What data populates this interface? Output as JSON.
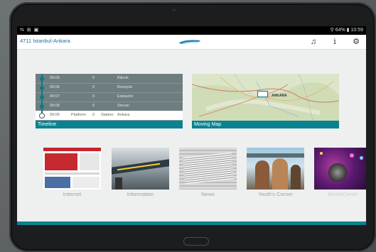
{
  "statusbar": {
    "left_icons": "⇆ ⊞ ▣",
    "right": "⚲ 64% ▮ 10:59"
  },
  "appbar": {
    "route_title": "4711 İstanbul-Ankara",
    "icons": [
      "music-icon",
      "info-icon",
      "settings-icon"
    ]
  },
  "timeline": {
    "caption": "Timeline",
    "rows": [
      {
        "time": "09:05",
        "platform": "0",
        "station": "Bilecik"
      },
      {
        "time": "09:06",
        "platform": "0",
        "station": "Bozüyük"
      },
      {
        "time": "09:07",
        "platform": "0",
        "station": "Eskişehir"
      },
      {
        "time": "09:08",
        "platform": "0",
        "station": "Sincan"
      },
      {
        "time": "09:09",
        "platform_label": "Platform:",
        "platform": "0",
        "station_label": "Station:",
        "station": "Ankara"
      }
    ]
  },
  "map": {
    "caption": "Moving Map",
    "city_label": "ANKARA"
  },
  "tiles": [
    {
      "label": "Internet"
    },
    {
      "label": "Information"
    },
    {
      "label": "News"
    },
    {
      "label": "Youth's Corner"
    },
    {
      "label": "MediaCenter"
    }
  ],
  "colors": {
    "accent": "#0a8290",
    "link": "#1e6fa0"
  }
}
